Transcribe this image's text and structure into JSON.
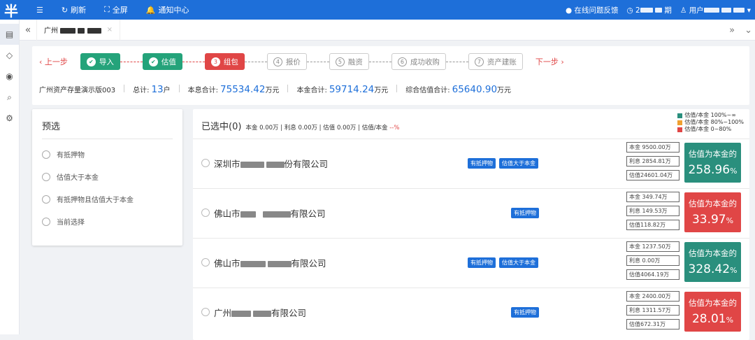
{
  "topbar": {
    "menu_icon": "menu-icon",
    "refresh": "刷新",
    "fullscreen": "全屏",
    "notifications": "通知中心",
    "feedback": "在线问题反馈",
    "clock_prefix": "2",
    "clock_suffix": "期",
    "user_prefix": "用户",
    "colors": {
      "bar": "#1e6fd9"
    }
  },
  "tabs": {
    "current_prefix": "广州"
  },
  "steps": {
    "prev": "上一步",
    "next": "下一步",
    "items": [
      {
        "num": "✔",
        "label": "导入",
        "state": "done"
      },
      {
        "num": "✔",
        "label": "估值",
        "state": "done"
      },
      {
        "num": "3",
        "label": "组包",
        "state": "current"
      },
      {
        "num": "4",
        "label": "报价",
        "state": "todo"
      },
      {
        "num": "5",
        "label": "融资",
        "state": "todo"
      },
      {
        "num": "6",
        "label": "成功收购",
        "state": "todo"
      },
      {
        "num": "7",
        "label": "资产建账",
        "state": "todo"
      }
    ]
  },
  "summary": {
    "name": "广州资产存量演示版003",
    "total_label": "总计:",
    "total_value": "13",
    "total_unit": "户",
    "interest_total_label": "本息合计:",
    "interest_total_value": "75534.42",
    "principal_total_label": "本金合计:",
    "principal_total_value": "59714.24",
    "valuation_total_label": "综合估值合计:",
    "valuation_total_value": "65640.90",
    "unit": "万元"
  },
  "preselect": {
    "title": "预选",
    "options": [
      "有抵押物",
      "估值大于本金",
      "有抵押物且估值大于本金",
      "当前选择"
    ]
  },
  "selected": {
    "title": "已选中(0)",
    "principal": "本金 0.00万",
    "interest": "利息 0.00万",
    "valuation": "估值 0.00万",
    "ratio_label": "估值/本金",
    "ratio_value": "--%"
  },
  "legend": [
    {
      "label": "估值/本金 100%~∞",
      "color": "#2a8f7d"
    },
    {
      "label": "估值/本金 80%~100%",
      "color": "#f0a030"
    },
    {
      "label": "估值/本金 0~80%",
      "color": "#e04646"
    }
  ],
  "rows": [
    {
      "name_pre": "深圳市",
      "name_post": "份有限公司",
      "tag1": "有抵押物",
      "tag2": "估值大于本金",
      "principal": "本金 9500.00万",
      "interest": "利息 2854.81万",
      "valuation": "估值24601.04万",
      "ratio_label": "估值为本金的",
      "ratio": "258.96",
      "pct": "%",
      "color": "green"
    },
    {
      "name_pre": "佛山市",
      "name_post": "有限公司",
      "tag1": "有抵押物",
      "tag2": "",
      "principal": "本金 349.74万",
      "interest": "利息 149.53万",
      "valuation": "估值118.82万",
      "ratio_label": "估值为本金的",
      "ratio": "33.97",
      "pct": "%",
      "color": "red"
    },
    {
      "name_pre": "佛山市",
      "name_post": "有限公司",
      "tag1": "有抵押物",
      "tag2": "估值大于本金",
      "principal": "本金 1237.50万",
      "interest": "利息 0.00万",
      "valuation": "估值4064.19万",
      "ratio_label": "估值为本金的",
      "ratio": "328.42",
      "pct": "%",
      "color": "green"
    },
    {
      "name_pre": "广州",
      "name_post": "有限公司",
      "tag1": "有抵押物",
      "tag2": "",
      "principal": "本金 2400.00万",
      "interest": "利息 1311.57万",
      "valuation": "估值672.31万",
      "ratio_label": "估值为本金的",
      "ratio": "28.01",
      "pct": "%",
      "color": "red"
    }
  ]
}
